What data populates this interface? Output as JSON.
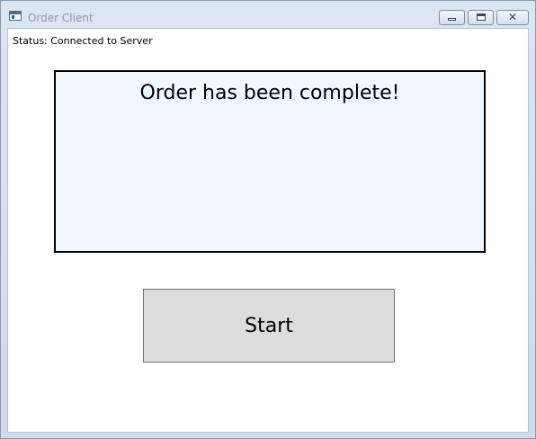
{
  "window": {
    "title": "Order Client",
    "minimize_icon": "minimize-icon",
    "maximize_icon": "maximize-icon",
    "close_icon": "close-icon",
    "close_glyph": "✕"
  },
  "status": {
    "text": "Status: Connected to Server"
  },
  "message": {
    "text": "Order has been complete!"
  },
  "actions": {
    "start_label": "Start"
  },
  "colors": {
    "message_background": "#eff7ff",
    "button_background": "#dddddd",
    "title_text": "#8d99a6"
  }
}
